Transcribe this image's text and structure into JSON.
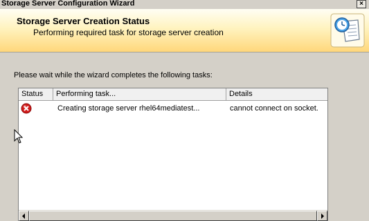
{
  "window": {
    "title": "Storage Server Configuration Wizard",
    "close_glyph": "×"
  },
  "header": {
    "title": "Storage Server Creation Status",
    "subtitle": "Performing required task for storage server creation",
    "logo_icon": "wizard-clock-scroll-icon"
  },
  "main": {
    "instruction": "Please wait while the wizard completes the following tasks:",
    "table": {
      "columns": [
        "Status",
        "Performing task...",
        "Details"
      ],
      "rows": [
        {
          "status_icon": "error-icon",
          "task": "Creating storage server rhel64mediatest...",
          "details": "cannot connect on socket."
        }
      ]
    }
  },
  "colors": {
    "banner_gradient_top": "#fffef4",
    "banner_gradient_bottom": "#ffd77b",
    "dialog_background": "#d4d0c8",
    "error_red": "#d11b1b"
  }
}
